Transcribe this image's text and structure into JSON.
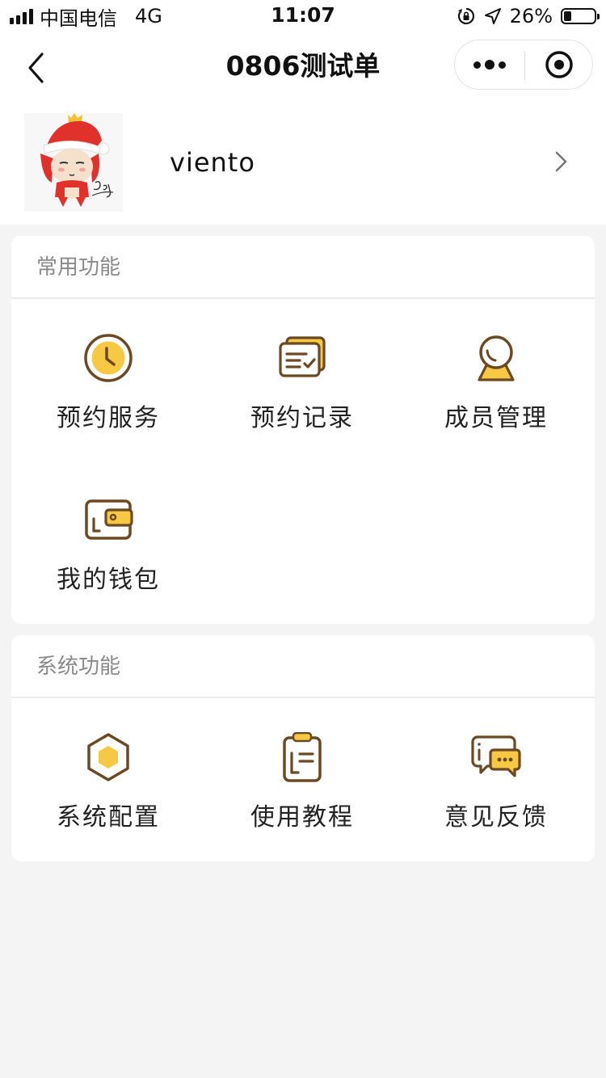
{
  "status_bar": {
    "carrier": "中国电信",
    "network": "4G",
    "time": "11:07",
    "battery": "26%",
    "battery_level": 0.26
  },
  "nav": {
    "title": "0806测试单"
  },
  "profile": {
    "username": "viento"
  },
  "sections": {
    "common": {
      "title": "常用功能",
      "items": [
        {
          "label": "预约服务",
          "icon": "clock-icon"
        },
        {
          "label": "预约记录",
          "icon": "records-icon"
        },
        {
          "label": "成员管理",
          "icon": "member-icon"
        },
        {
          "label": "我的钱包",
          "icon": "wallet-icon"
        }
      ]
    },
    "system": {
      "title": "系统功能",
      "items": [
        {
          "label": "系统配置",
          "icon": "hexagon-settings-icon"
        },
        {
          "label": "使用教程",
          "icon": "clipboard-icon"
        },
        {
          "label": "意见反馈",
          "icon": "feedback-chat-icon"
        }
      ]
    }
  },
  "colors": {
    "accent_yellow": "#f6c844",
    "icon_brown": "#6b4a23",
    "background": "#f4f4f4"
  }
}
